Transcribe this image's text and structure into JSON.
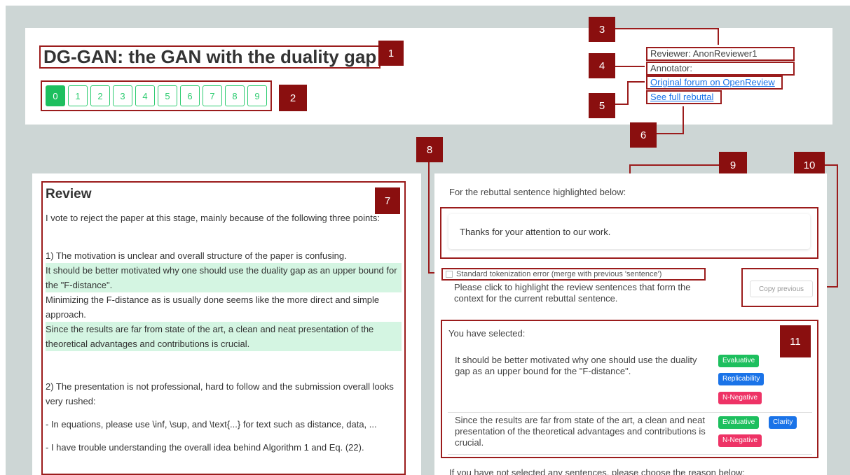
{
  "paper_title": "DG-GAN: the GAN with the duality gap",
  "pagination": [
    "0",
    "1",
    "2",
    "3",
    "4",
    "5",
    "6",
    "7",
    "8",
    "9"
  ],
  "meta": {
    "reviewer": "Reviewer: AnonReviewer1",
    "annotator": "Annotator:",
    "forum_link": "Original forum on OpenReview",
    "rebuttal_link": "See full rebuttal"
  },
  "badges": [
    "1",
    "2",
    "3",
    "4",
    "5",
    "6",
    "7",
    "8",
    "9",
    "10",
    "11"
  ],
  "review": {
    "heading": "Review",
    "paragraphs": [
      "I vote to reject the paper at this stage, mainly because of the following three points:",
      "1) The motivation is unclear and overall structure of the paper is confusing.",
      "It should be better motivated why one should use the duality gap as an upper bound for the \"F-distance\".",
      "Minimizing the F-distance as is usually done seems like the more direct and simple approach.",
      "Since the results are far from state of the art, a clean and neat presentation of the theoretical advantages and contributions is crucial.",
      "2) The presentation is not professional, hard to follow and the submission overall looks very rushed:",
      "- In equations, please use \\inf, \\sup, and \\text{...} for text such as distance, data, ...",
      "- I have trouble understanding the overall idea behind Algorithm 1 and Eq. (22)."
    ]
  },
  "rebuttal": {
    "prompt": "For the rebuttal sentence highlighted below:",
    "sentence": "Thanks for your attention to our work.",
    "tokenization_label": "Standard tokenization error (merge with previous 'sentence')",
    "context_instruction": "Please click to highlight the review sentences that form the context for the current rebuttal sentence.",
    "copy_button": "Copy previous",
    "selected_title": "You have selected:",
    "selected": [
      {
        "text": "It should be better motivated why one should use the duality gap as an upper bound for the \"F-distance\".",
        "tags": [
          "Evaluative",
          "Replicability",
          "N-Negative"
        ]
      },
      {
        "text": "Since the results are far from state of the art, a clean and neat presentation of the theoretical advantages and contributions is crucial.",
        "tags": [
          "Evaluative",
          "Clarity",
          "N-Negative"
        ]
      }
    ],
    "bottom_prompt": "If you have not selected any sentences, please choose the reason below:"
  },
  "colors": {
    "accent_green": "#1dbf5e",
    "annotation_red": "#9b1c1c",
    "badge_dark_red": "#8a0f0f",
    "link_blue": "#1a73e8",
    "tag_pink": "#ee3366",
    "highlight_green": "#d4f5e2"
  }
}
